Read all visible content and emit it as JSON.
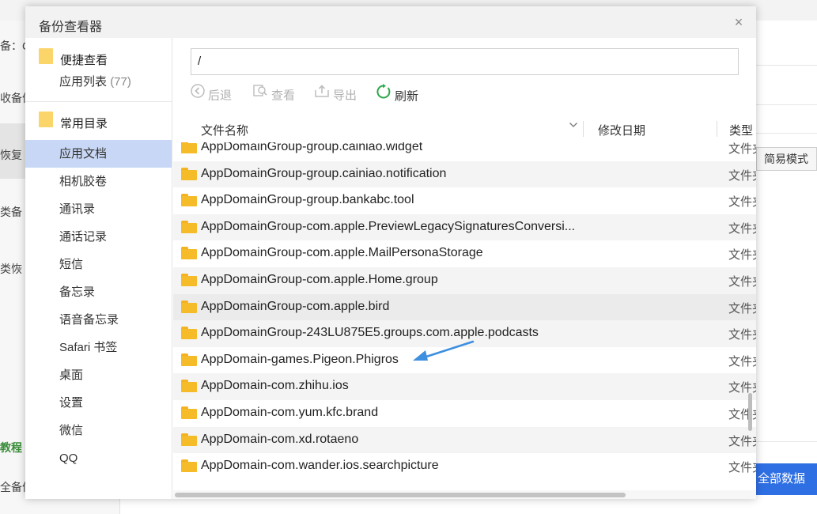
{
  "background": {
    "left_fragments": [
      "备：Ci",
      "收备份",
      "恢复",
      "类备",
      "类恢",
      "教程",
      "全备份"
    ],
    "simple_mode_label": "简易模式",
    "all_data_label": "全部数据"
  },
  "dialog": {
    "title": "备份查看器",
    "close_label": "×"
  },
  "sidebar": {
    "quick_view": {
      "label": "便捷查看",
      "app_list_label": "应用列表",
      "app_list_count": "(77)"
    },
    "common_dirs": {
      "label": "常用目录",
      "items": [
        "应用文档",
        "相机胶卷",
        "通讯录",
        "通话记录",
        "短信",
        "备忘录",
        "语音备忘录",
        "Safari 书签",
        "桌面",
        "设置",
        "微信",
        "QQ"
      ]
    }
  },
  "path": {
    "value": "/"
  },
  "toolbar": {
    "back_label": "后退",
    "view_label": "查看",
    "export_label": "导出",
    "refresh_label": "刷新"
  },
  "table": {
    "headers": {
      "name": "文件名称",
      "modified": "修改日期",
      "type": "类型"
    },
    "rows": [
      {
        "name": "AppDomainGroup-group.cainiao.widget",
        "type": "文件夹"
      },
      {
        "name": "AppDomainGroup-group.cainiao.notification",
        "type": "文件夹"
      },
      {
        "name": "AppDomainGroup-group.bankabc.tool",
        "type": "文件夹"
      },
      {
        "name": "AppDomainGroup-com.apple.PreviewLegacySignaturesConversi...",
        "type": "文件夹"
      },
      {
        "name": "AppDomainGroup-com.apple.MailPersonaStorage",
        "type": "文件夹"
      },
      {
        "name": "AppDomainGroup-com.apple.Home.group",
        "type": "文件夹"
      },
      {
        "name": "AppDomainGroup-com.apple.bird",
        "type": "文件夹"
      },
      {
        "name": "AppDomainGroup-243LU875E5.groups.com.apple.podcasts",
        "type": "文件夹"
      },
      {
        "name": "AppDomain-games.Pigeon.Phigros",
        "type": "文件夹"
      },
      {
        "name": "AppDomain-com.zhihu.ios",
        "type": "文件夹"
      },
      {
        "name": "AppDomain-com.yum.kfc.brand",
        "type": "文件夹"
      },
      {
        "name": "AppDomain-com.xd.rotaeno",
        "type": "文件夹"
      },
      {
        "name": "AppDomain-com.wander.ios.searchpicture",
        "type": "文件夹"
      }
    ]
  },
  "colors": {
    "accent_blue": "#2f6fe4",
    "selection": "#c8d7f5",
    "folder_yellow": "#f5bb28",
    "refresh_green": "#2ea84a",
    "annotation_arrow": "#3d8fe0"
  }
}
